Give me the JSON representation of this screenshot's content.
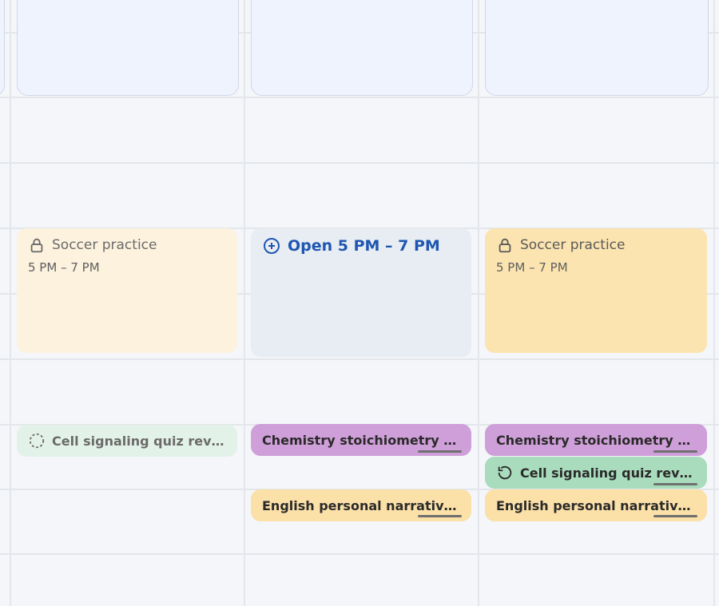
{
  "events": {
    "soccer_mon": {
      "title": "Soccer practice",
      "time": "5 PM – 7 PM"
    },
    "open_tue": {
      "title": "Open 5 PM – 7 PM"
    },
    "soccer_wed": {
      "title": "Soccer practice",
      "time": "5 PM – 7 PM"
    }
  },
  "tasks": {
    "cell_mon": "Cell signaling quiz review",
    "chem_tue": "Chemistry stoichiometry pr...",
    "english_tue": "English personal narrative r...",
    "chem_wed": "Chemistry stoichiometry pr...",
    "cell_wed": "Cell signaling quiz review",
    "english_wed": "English personal narrative r..."
  },
  "colors": {
    "open_accent": "#1f57b0",
    "soccer_light": "#fdf2de",
    "soccer_dark": "#fbe4b0",
    "task_purple": "#cf9fd9",
    "task_green_light": "#e3f2e8",
    "task_green_dark": "#a9dcbc",
    "task_yellow": "#fbe0a8"
  },
  "icons": {
    "soccer": "lock-icon",
    "open": "add-circle-icon",
    "cell_mon": "dashed-circle-icon",
    "cell_wed": "refresh-icon"
  }
}
